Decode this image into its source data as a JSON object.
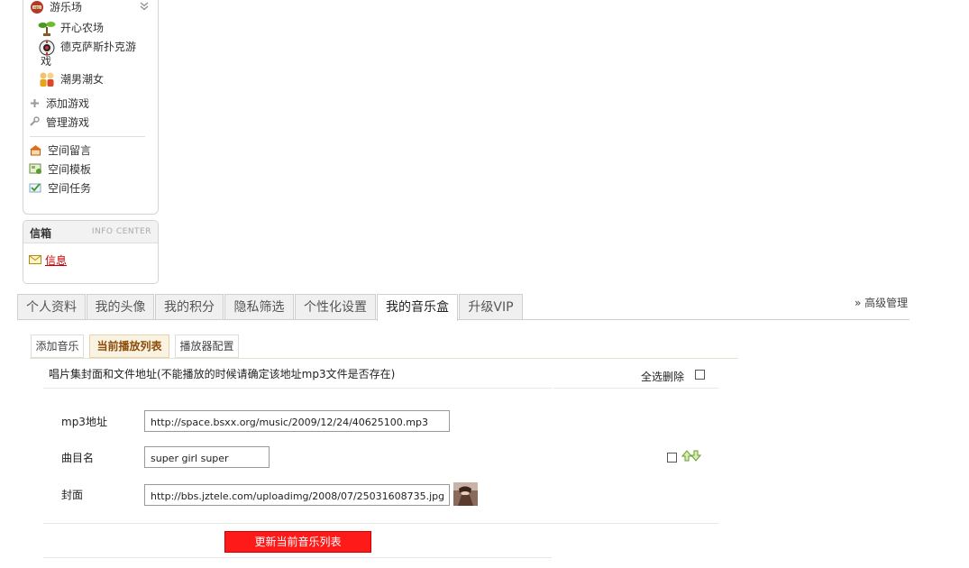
{
  "sidebar": {
    "playground": {
      "title": "游乐场"
    },
    "games": [
      {
        "label": "开心农场",
        "icon": "sprout-icon"
      },
      {
        "label_line1": "德克萨斯扑克游",
        "label_line2": "戏",
        "icon": "poker-chip-icon"
      },
      {
        "label": "潮男潮女",
        "icon": "couple-icon"
      }
    ],
    "actions": [
      {
        "label": "添加游戏",
        "icon": "plus-icon"
      },
      {
        "label": "管理游戏",
        "icon": "wrench-icon"
      }
    ],
    "space_links": [
      {
        "label": "空间留言",
        "icon": "message-house-icon"
      },
      {
        "label": "空间模板",
        "icon": "template-icon"
      },
      {
        "label": "空间任务",
        "icon": "task-check-icon"
      }
    ],
    "inbox": {
      "title": "信箱",
      "subtitle": "INFO CENTER",
      "link": "信息"
    }
  },
  "tabs": [
    {
      "label": "个人资料"
    },
    {
      "label": "我的头像"
    },
    {
      "label": "我的积分"
    },
    {
      "label": "隐私筛选"
    },
    {
      "label": "个性化设置"
    },
    {
      "label": "我的音乐盒",
      "active": true
    },
    {
      "label": "升级VIP"
    }
  ],
  "advanced_manage": "» 高级管理",
  "subtabs": [
    {
      "label": "添加音乐"
    },
    {
      "label": "当前播放列表",
      "active": true
    },
    {
      "label": "播放器配置"
    }
  ],
  "playlist": {
    "header": "唱片集封面和文件地址(不能播放的时候请确定该地址mp3文件是否存在)",
    "select_all": "全选删除",
    "fields": {
      "mp3_label": "mp3地址",
      "mp3_value": "http://space.bsxx.org/music/2009/12/24/40625100.mp3",
      "title_label": "曲目名",
      "title_value": "super girl super",
      "cover_label": "封面",
      "cover_value": "http://bbs.jztele.com/uploadimg/2008/07/25031608735.jpg"
    },
    "submit": "更新当前音乐列表"
  },
  "colors": {
    "accent_red": "#ff1a1a",
    "link_red": "#cc0000",
    "active_subtab_bg": "#fbf3e2",
    "active_subtab_text": "#8a4b08"
  }
}
